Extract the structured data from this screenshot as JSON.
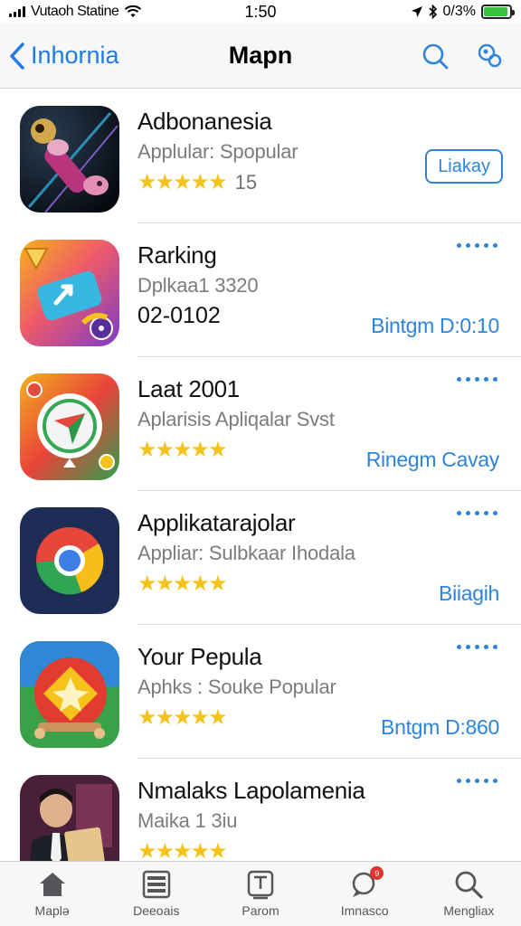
{
  "status_bar": {
    "carrier": "Vutaoh Statine",
    "time": "1:50",
    "battery": "0/3%",
    "battery_level": 0.92
  },
  "nav": {
    "back_label": "Inhornia",
    "title": "Mapn"
  },
  "apps": [
    {
      "name": "Adbonanesia",
      "subtitle": "Applular: Spopular",
      "stars": "★★★★★",
      "rating_count": "15",
      "button": "Liakay"
    },
    {
      "name": "Rarking",
      "subtitle": "Dplkaa1 3320",
      "date": "02-0102",
      "action": "Bintgm D:0:10"
    },
    {
      "name": "Laat 2001",
      "subtitle": "Aplarisis Apliqalar Svst",
      "stars": "★★★★★",
      "action": "Rinegm Cavay"
    },
    {
      "name": "Applikatarajolar",
      "subtitle": "Appliar: Sulbkaar Ihodala",
      "stars": "★★★★★",
      "action": "Biiagih"
    },
    {
      "name": "Your Pepula",
      "subtitle": "Aphks : Souke Popular",
      "stars": "★★★★★",
      "action": "Bntgm D:860"
    },
    {
      "name": "Nmalaks Lapolamenia",
      "subtitle": "Maika 1 3iu",
      "stars": "★★★★★"
    }
  ],
  "tabs": [
    {
      "label": "Maplə"
    },
    {
      "label": "Deeoais"
    },
    {
      "label": "Parom"
    },
    {
      "label": "Imnasco",
      "badge": "9"
    },
    {
      "label": "Mengliax"
    }
  ],
  "colors": {
    "accent": "#2f84d9",
    "star": "#f6c31d",
    "badge": "#e2302a",
    "battery": "#37c23d"
  }
}
